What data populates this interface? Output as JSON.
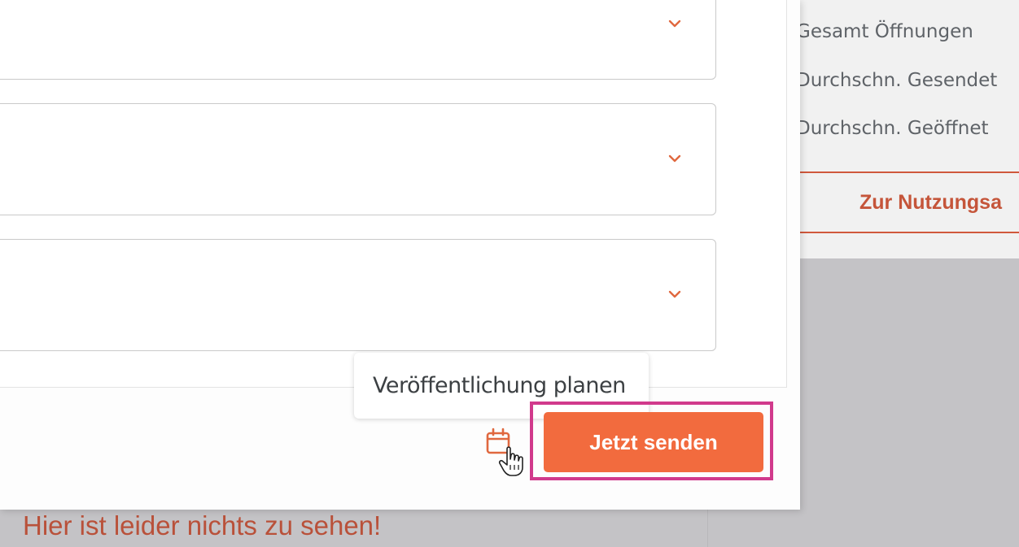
{
  "sidebar_stats": {
    "total_opens": "Gesamt Öffnungen",
    "avg_sent": "Durchschn. Gesendet",
    "avg_opened": "Durchschn. Geöffnet",
    "usage_button": "Zur Nutzungsa"
  },
  "modal": {
    "selects": [
      {
        "value": ""
      },
      {
        "value": ""
      },
      {
        "value": ""
      }
    ],
    "tooltip": "Veröffentlichung planen",
    "send_button": "Jetzt senden",
    "schedule_icon": "calendar-icon"
  },
  "background": {
    "empty_message": "Hier ist leider nichts zu sehen!"
  },
  "colors": {
    "accent": "#f26b3e",
    "highlight": "#d13a8c",
    "link": "#c5553a"
  }
}
